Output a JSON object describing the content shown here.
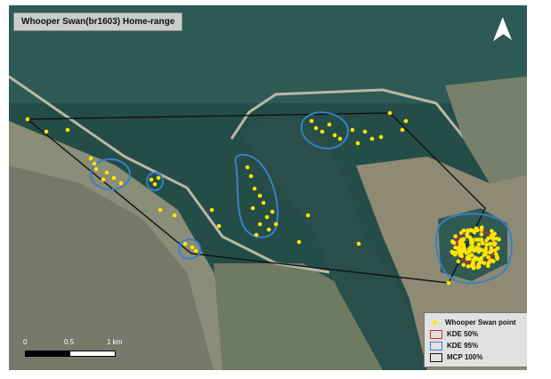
{
  "title": "Whooper Swan(br1603) Home-range",
  "north_arrow": {
    "icon": "north-arrow-icon"
  },
  "legend": {
    "items": [
      {
        "label": "Whooper Swan point",
        "symbol": "yellow-point",
        "color": "#ffe600"
      },
      {
        "label": "KDE 50%",
        "symbol": "outline-box",
        "color": "#e0202a"
      },
      {
        "label": "KDE 95%",
        "symbol": "outline-box",
        "color": "#3a7fc8"
      },
      {
        "label": "MCP 100%",
        "symbol": "outline-box",
        "color": "#111111"
      }
    ]
  },
  "scale_bar": {
    "labels": [
      "0",
      "0.5",
      "1 km"
    ]
  },
  "colors": {
    "water": "#234a44",
    "land": "#8c8f7c",
    "point": "#ffe600",
    "kde50": "#e0202a",
    "kde95": "#3a7fc8",
    "mcp": "#111111"
  }
}
